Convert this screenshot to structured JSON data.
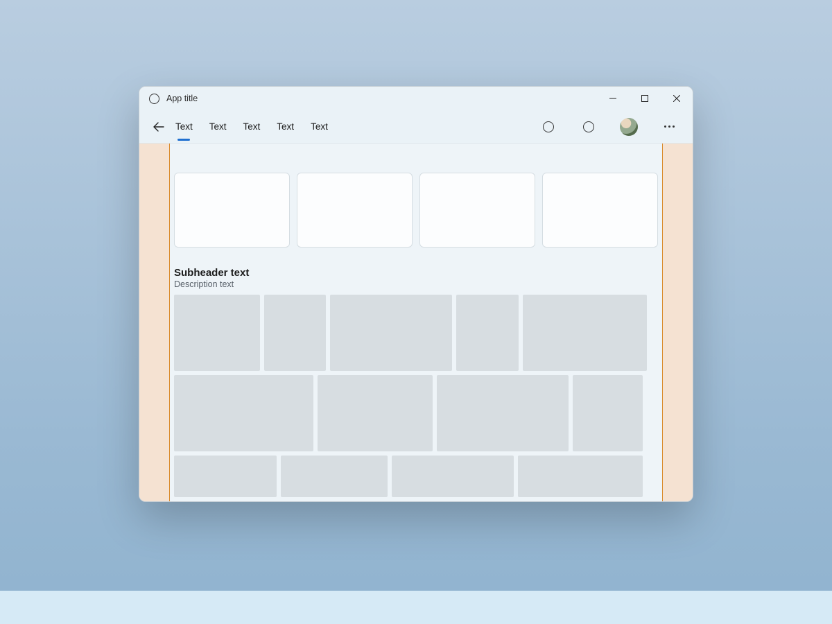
{
  "titlebar": {
    "app_title": "App title"
  },
  "tabs": {
    "items": [
      {
        "label": "Text"
      },
      {
        "label": "Text"
      },
      {
        "label": "Text"
      },
      {
        "label": "Text"
      },
      {
        "label": "Text"
      }
    ],
    "active_index": 0
  },
  "section": {
    "subheader": "Subheader text",
    "description": "Description text"
  },
  "colors": {
    "accent": "#1f6fd0",
    "gutter_fill": "#f5e2d2",
    "gutter_edge": "#d98a2b",
    "tile": "#d7dde1"
  }
}
